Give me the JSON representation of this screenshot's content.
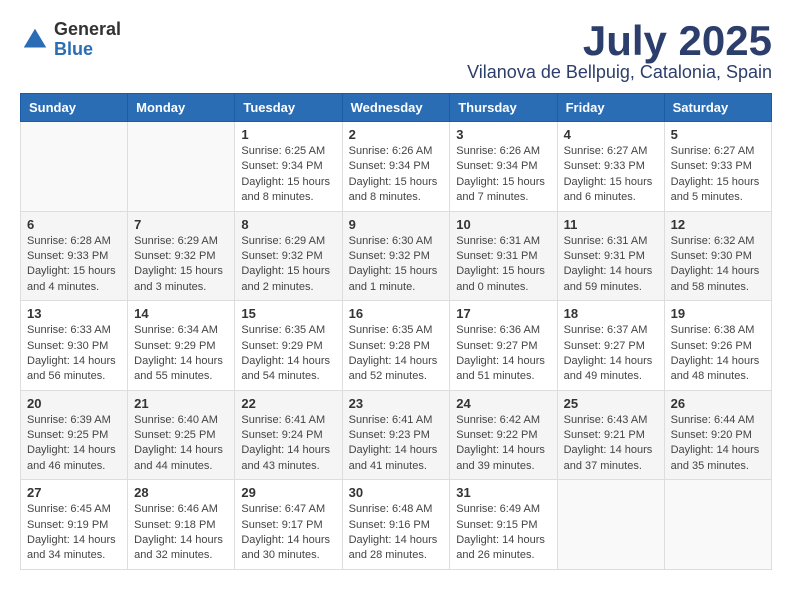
{
  "logo": {
    "general": "General",
    "blue": "Blue"
  },
  "title": {
    "month": "July 2025",
    "location": "Vilanova de Bellpuig, Catalonia, Spain"
  },
  "days_of_week": [
    "Sunday",
    "Monday",
    "Tuesday",
    "Wednesday",
    "Thursday",
    "Friday",
    "Saturday"
  ],
  "weeks": [
    [
      {
        "day": "",
        "info": ""
      },
      {
        "day": "",
        "info": ""
      },
      {
        "day": "1",
        "info": "Sunrise: 6:25 AM\nSunset: 9:34 PM\nDaylight: 15 hours and 8 minutes."
      },
      {
        "day": "2",
        "info": "Sunrise: 6:26 AM\nSunset: 9:34 PM\nDaylight: 15 hours and 8 minutes."
      },
      {
        "day": "3",
        "info": "Sunrise: 6:26 AM\nSunset: 9:34 PM\nDaylight: 15 hours and 7 minutes."
      },
      {
        "day": "4",
        "info": "Sunrise: 6:27 AM\nSunset: 9:33 PM\nDaylight: 15 hours and 6 minutes."
      },
      {
        "day": "5",
        "info": "Sunrise: 6:27 AM\nSunset: 9:33 PM\nDaylight: 15 hours and 5 minutes."
      }
    ],
    [
      {
        "day": "6",
        "info": "Sunrise: 6:28 AM\nSunset: 9:33 PM\nDaylight: 15 hours and 4 minutes."
      },
      {
        "day": "7",
        "info": "Sunrise: 6:29 AM\nSunset: 9:32 PM\nDaylight: 15 hours and 3 minutes."
      },
      {
        "day": "8",
        "info": "Sunrise: 6:29 AM\nSunset: 9:32 PM\nDaylight: 15 hours and 2 minutes."
      },
      {
        "day": "9",
        "info": "Sunrise: 6:30 AM\nSunset: 9:32 PM\nDaylight: 15 hours and 1 minute."
      },
      {
        "day": "10",
        "info": "Sunrise: 6:31 AM\nSunset: 9:31 PM\nDaylight: 15 hours and 0 minutes."
      },
      {
        "day": "11",
        "info": "Sunrise: 6:31 AM\nSunset: 9:31 PM\nDaylight: 14 hours and 59 minutes."
      },
      {
        "day": "12",
        "info": "Sunrise: 6:32 AM\nSunset: 9:30 PM\nDaylight: 14 hours and 58 minutes."
      }
    ],
    [
      {
        "day": "13",
        "info": "Sunrise: 6:33 AM\nSunset: 9:30 PM\nDaylight: 14 hours and 56 minutes."
      },
      {
        "day": "14",
        "info": "Sunrise: 6:34 AM\nSunset: 9:29 PM\nDaylight: 14 hours and 55 minutes."
      },
      {
        "day": "15",
        "info": "Sunrise: 6:35 AM\nSunset: 9:29 PM\nDaylight: 14 hours and 54 minutes."
      },
      {
        "day": "16",
        "info": "Sunrise: 6:35 AM\nSunset: 9:28 PM\nDaylight: 14 hours and 52 minutes."
      },
      {
        "day": "17",
        "info": "Sunrise: 6:36 AM\nSunset: 9:27 PM\nDaylight: 14 hours and 51 minutes."
      },
      {
        "day": "18",
        "info": "Sunrise: 6:37 AM\nSunset: 9:27 PM\nDaylight: 14 hours and 49 minutes."
      },
      {
        "day": "19",
        "info": "Sunrise: 6:38 AM\nSunset: 9:26 PM\nDaylight: 14 hours and 48 minutes."
      }
    ],
    [
      {
        "day": "20",
        "info": "Sunrise: 6:39 AM\nSunset: 9:25 PM\nDaylight: 14 hours and 46 minutes."
      },
      {
        "day": "21",
        "info": "Sunrise: 6:40 AM\nSunset: 9:25 PM\nDaylight: 14 hours and 44 minutes."
      },
      {
        "day": "22",
        "info": "Sunrise: 6:41 AM\nSunset: 9:24 PM\nDaylight: 14 hours and 43 minutes."
      },
      {
        "day": "23",
        "info": "Sunrise: 6:41 AM\nSunset: 9:23 PM\nDaylight: 14 hours and 41 minutes."
      },
      {
        "day": "24",
        "info": "Sunrise: 6:42 AM\nSunset: 9:22 PM\nDaylight: 14 hours and 39 minutes."
      },
      {
        "day": "25",
        "info": "Sunrise: 6:43 AM\nSunset: 9:21 PM\nDaylight: 14 hours and 37 minutes."
      },
      {
        "day": "26",
        "info": "Sunrise: 6:44 AM\nSunset: 9:20 PM\nDaylight: 14 hours and 35 minutes."
      }
    ],
    [
      {
        "day": "27",
        "info": "Sunrise: 6:45 AM\nSunset: 9:19 PM\nDaylight: 14 hours and 34 minutes."
      },
      {
        "day": "28",
        "info": "Sunrise: 6:46 AM\nSunset: 9:18 PM\nDaylight: 14 hours and 32 minutes."
      },
      {
        "day": "29",
        "info": "Sunrise: 6:47 AM\nSunset: 9:17 PM\nDaylight: 14 hours and 30 minutes."
      },
      {
        "day": "30",
        "info": "Sunrise: 6:48 AM\nSunset: 9:16 PM\nDaylight: 14 hours and 28 minutes."
      },
      {
        "day": "31",
        "info": "Sunrise: 6:49 AM\nSunset: 9:15 PM\nDaylight: 14 hours and 26 minutes."
      },
      {
        "day": "",
        "info": ""
      },
      {
        "day": "",
        "info": ""
      }
    ]
  ]
}
